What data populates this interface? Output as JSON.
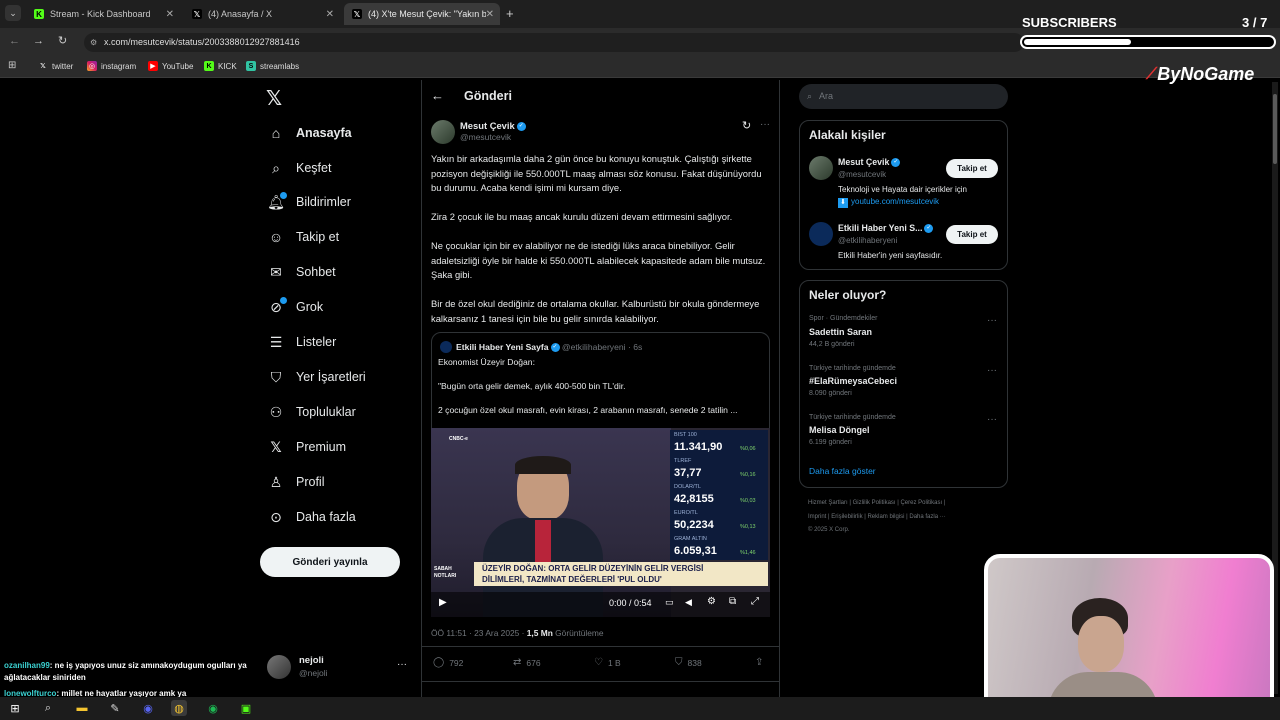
{
  "browser": {
    "tabs": [
      {
        "title": "Stream - Kick Dashboard",
        "icon": "kick-icon"
      },
      {
        "title": "(4) Anasayfa / X",
        "icon": "x-icon"
      },
      {
        "title": "(4) X'te Mesut Çevik: \"Yakın bir",
        "icon": "x-icon"
      }
    ],
    "new_tab": "+",
    "url": "x.com/mesutcevik/status/2003388012927881416",
    "bookmarks": [
      "twitter",
      "instagram",
      "YouTube",
      "KICK",
      "streamlabs"
    ]
  },
  "overlay": {
    "subscribers_label": "SUBSCRIBERS",
    "subscribers_count": "3 / 7",
    "subscribers_progress": 0.43,
    "brand": "ByNoGame"
  },
  "nav": {
    "items": [
      "Anasayfa",
      "Keşfet",
      "Bildirimler",
      "Takip et",
      "Sohbet",
      "Grok",
      "Listeler",
      "Yer İşaretleri",
      "Topluluklar",
      "Premium",
      "Profil",
      "Daha fazla"
    ],
    "post_button": "Gönderi yayınla",
    "account_name": "nejoli",
    "account_handle": "@nejoli",
    "more": "···"
  },
  "post": {
    "header": "Gönderi",
    "author_name": "Mesut Çevik",
    "author_handle": "@mesutcevik",
    "paragraphs": [
      "Yakın bir arkadaşımla daha 2 gün önce bu konuyu konuştuk. Çalıştığı şirkette pozisyon değişikliği ile 550.000TL maaş alması söz konusu. Fakat düşünüyordu bu durumu. Acaba kendi işimi mi kursam diye.",
      "Zira 2 çocuk ile bu maaş ancak kurulu düzeni devam ettirmesini sağlıyor.",
      "Ne çocuklar için bir ev alabiliyor ne de istediği lüks araca binebiliyor. Gelir adaletsizliği öyle bir halde ki 550.000TL alabilecek kapasitede adam bile mutsuz. Şaka gibi.",
      "Bir de özel okul dediğiniz de ortalama okullar. Kalburüstü bir okula göndermeye kalkarsanız 1 tanesi için bile bu gelir sınırda kalabiliyor."
    ],
    "quote": {
      "author_name": "Etkili Haber Yeni Sayfa",
      "author_handle": "@etkilihaberyeni",
      "time": "6s",
      "lines": [
        "Ekonomist Üzeyir Doğan:",
        "\"Bugün orta gelir demek, aylık 400-500 bin TL'dir.",
        "2 çocuğun özel okul masrafı, evin kirası, 2 arabanın masrafı, senede 2 tatilin ..."
      ],
      "video": {
        "ticker": [
          {
            "label": "BIST 100",
            "value": "11.341,90",
            "change": "%0,06"
          },
          {
            "label": "TLREF",
            "value": "37,77",
            "change": "%0,16"
          },
          {
            "label": "DOLAR/TL",
            "value": "42,8155",
            "change": "%0,03"
          },
          {
            "label": "EURO/TL",
            "value": "50,2234",
            "change": "%0,13"
          },
          {
            "label": "GRAM ALTIN",
            "value": "6.059,31",
            "change": "%1,46"
          }
        ],
        "channel": "CNBC-e",
        "show": "SABAH NOTLARI",
        "headline_1": "ÜZEYİR DOĞAN: ORTA GELİR DÜZEYİNİN GELİR VERGİSİ",
        "headline_2": "DİLİMLERİ, TAZMİNAT DEĞERLERİ 'PUL OLDU'",
        "time": "0:00 / 0:54"
      }
    },
    "meta_time": "ÖÖ 11:51 · 23 Ara 2025 ·",
    "meta_views": "1,5 Mn",
    "meta_views_label": "Görüntüleme",
    "stats": {
      "replies": "792",
      "reposts": "676",
      "likes": "1 B",
      "bookmarks": "838"
    }
  },
  "sidebar": {
    "search_placeholder": "Ara",
    "related_title": "Alakalı kişiler",
    "people": [
      {
        "name": "Mesut Çevik",
        "handle": "@mesutcevik",
        "bio": "Teknoloji ve Hayata dair içerikler için",
        "link": "youtube.com/mesutcevik",
        "button": "Takip et"
      },
      {
        "name": "Etkili Haber Yeni S...",
        "handle": "@etkilihaberyeni",
        "bio": "Etkili Haber'in yeni sayfasıdır.",
        "button": "Takip et"
      }
    ],
    "trends_title": "Neler oluyor?",
    "trends": [
      {
        "category": "Spor · Gündemdekiler",
        "name": "Sadettin Saran",
        "count": "44,2 B gönderi"
      },
      {
        "category": "Türkiye tarihinde gündemde",
        "name": "#ElaRümeysaCebeci",
        "count": "8.090 gönderi"
      },
      {
        "category": "Türkiye tarihinde gündemde",
        "name": "Melisa Döngel",
        "count": "6.199 gönderi"
      }
    ],
    "show_more": "Daha fazla göster",
    "footer_1": "Hizmet Şartları  |  Gizlilik Politikası  |  Çerez Politikası  |",
    "footer_2": "Imprint  |  Erişilebilirlik  |  Reklam bilgisi  |  Daha fazla ···",
    "footer_3": "© 2025 X Corp."
  },
  "chat": [
    {
      "user": "ozanilhan99",
      "text": ": ne iş yapıyos unuz siz amınakoydugum ogulları ya ağlatacaklar siniriden"
    },
    {
      "user": "lonewolfturco",
      "text": ": millet ne hayatlar yaşıyor amk ya"
    }
  ]
}
